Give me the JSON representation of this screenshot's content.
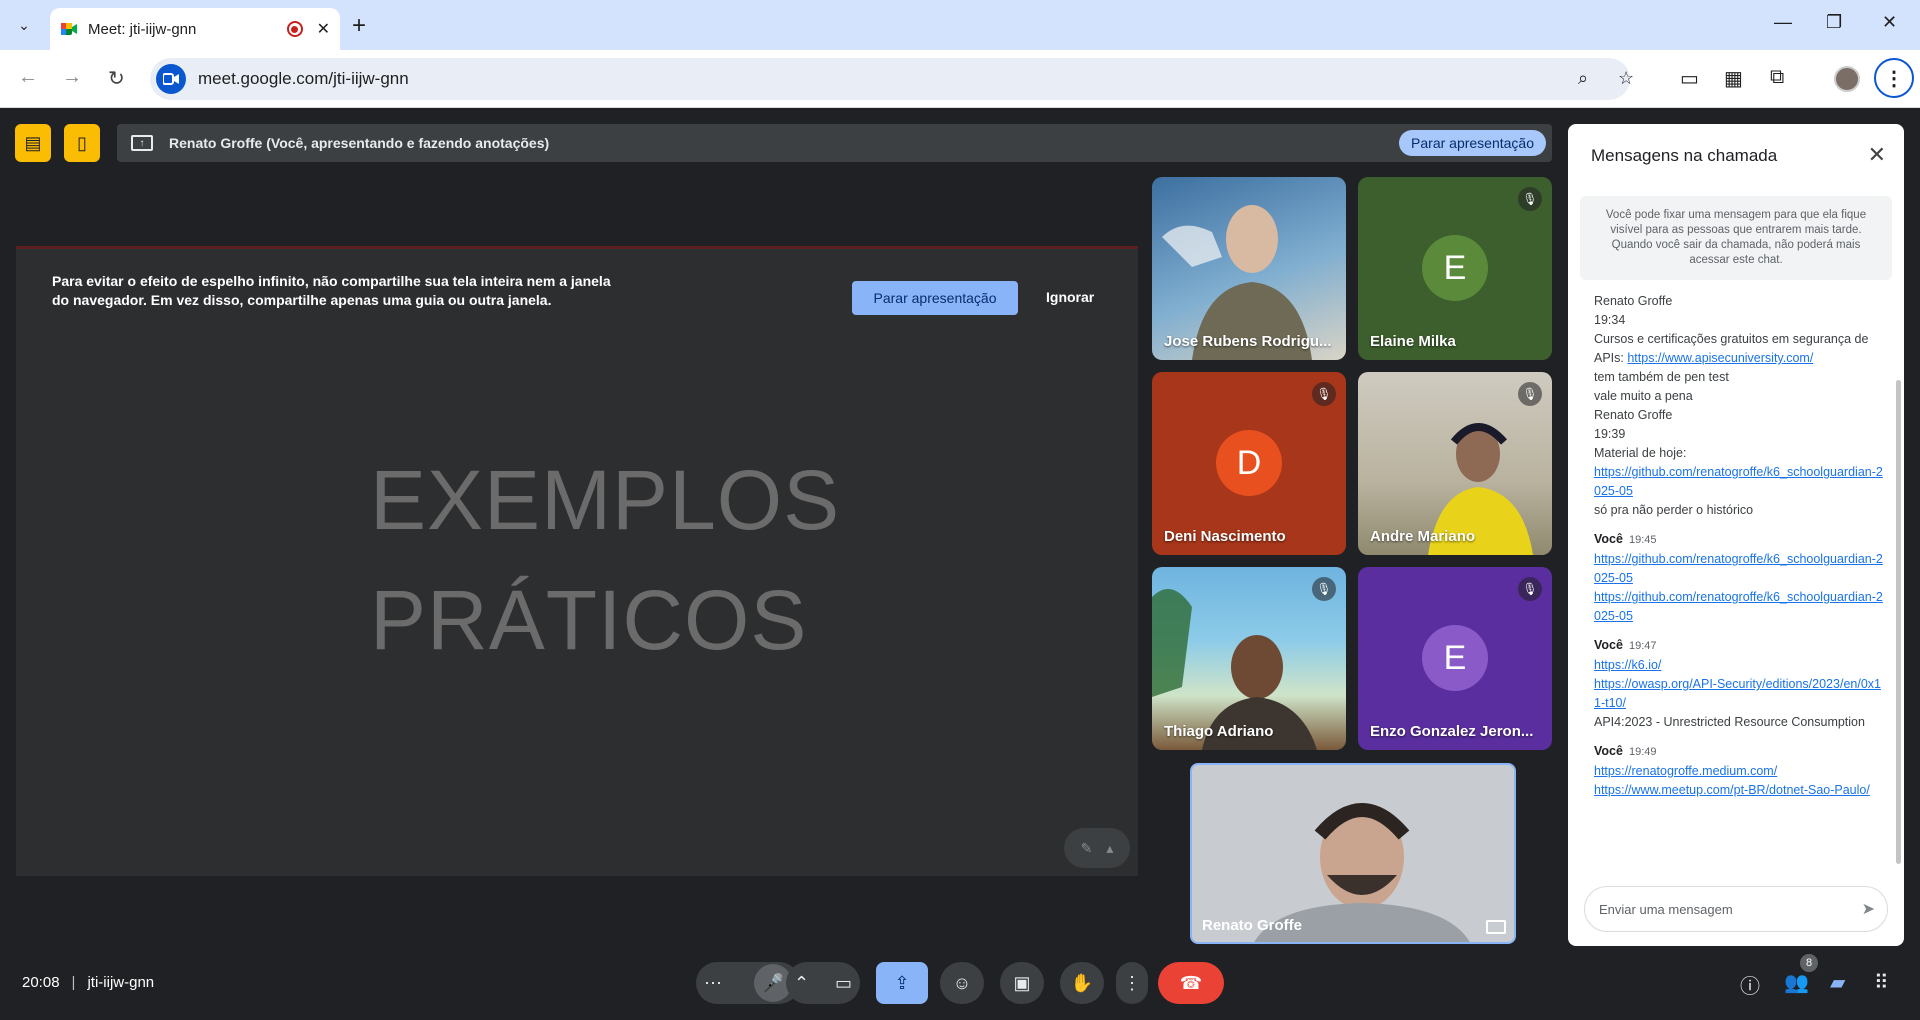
{
  "browser": {
    "tab_title": "Meet: jti-iijw-gnn",
    "url": "meet.google.com/jti-iijw-gnn",
    "tab_close": "✕",
    "new_tab": "+"
  },
  "presenting_bar": {
    "text": "Renato Groffe (Você, apresentando e fazendo anotações)",
    "stop_button": "Parar apresentação"
  },
  "warning": {
    "text": "Para evitar o efeito de espelho infinito, não compartilhe sua tela inteira nem a janela do navegador. Em vez disso, compartilhe apenas uma guia ou outra janela.",
    "stop_button": "Parar apresentação",
    "ignore_button": "Ignorar"
  },
  "slide": {
    "line1": "EXEMPLOS",
    "line2": "PRÁTICOS"
  },
  "participants": [
    {
      "name": "Jose Rubens Rodrigu...",
      "initial": "",
      "color": "#4a6b8a",
      "muted": false
    },
    {
      "name": "Elaine Milka",
      "initial": "E",
      "color": "#5a8a3a",
      "muted": true
    },
    {
      "name": "Deni Nascimento",
      "initial": "D",
      "color": "#c0431e",
      "muted": true
    },
    {
      "name": "Andre Mariano",
      "initial": "",
      "color": "#a59a7c",
      "muted": true
    },
    {
      "name": "Thiago Adriano",
      "initial": "",
      "color": "#5a9ab5",
      "muted": true
    },
    {
      "name": "Enzo Gonzalez Jeron...",
      "initial": "E",
      "color": "#6d3fb0",
      "muted": true
    }
  ],
  "self": {
    "name": "Renato Groffe"
  },
  "chat": {
    "title": "Mensagens na chamada",
    "info": "Você pode fixar uma mensagem para que ela fique visível para as pessoas que entrarem mais tarde. Quando você sair da chamada, não poderá mais acessar este chat.",
    "messages": {
      "m1_sender": "Renato Groffe",
      "m1_time": "19:34",
      "m1_text": "Cursos e certificações gratuitos em segurança de APIs:",
      "m1_link": "https://www.apisecuniversity.com/",
      "m1_text2": "tem também de pen test",
      "m1_text3": "vale muito a pena",
      "m2_sender": "Renato Groffe",
      "m2_time": "19:39",
      "m2_text": "Material de hoje:",
      "m2_link": "https://github.com/renatogroffe/k6_schoolguardian-2025-05",
      "m2_text2": "só pra não perder o histórico",
      "m3_sender": "Você",
      "m3_time": "19:45",
      "m3_link1": "https://github.com/renatogroffe/k6_schoolguardian-2025-05",
      "m3_link2": "https://github.com/renatogroffe/k6_schoolguardian-2025-05",
      "m4_sender": "Você",
      "m4_time": "19:47",
      "m4_link1": "https://k6.io/",
      "m4_link2": "https://owasp.org/API-Security/editions/2023/en/0x11-t10/",
      "m4_text": "API4:2023 - Unrestricted Resource Consumption",
      "m5_sender": "Você",
      "m5_time": "19:49",
      "m5_link1": "https://renatogroffe.medium.com/",
      "m5_link2": "https://www.meetup.com/pt-BR/dotnet-Sao-Paulo/"
    },
    "input_placeholder": "Enviar uma mensagem"
  },
  "bottom": {
    "time": "20:08",
    "meeting_code": "jti-iijw-gnn",
    "participant_count": "8"
  },
  "colors": {
    "accent": "#8ab4f8",
    "end_call": "#ea4335",
    "warning_yellow": "#fbbc04"
  }
}
